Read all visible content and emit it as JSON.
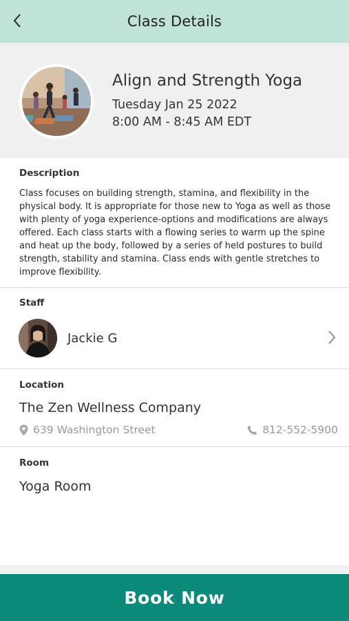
{
  "header": {
    "title": "Class Details"
  },
  "class_info": {
    "name": "Align and Strength Yoga",
    "date": "Tuesday Jan 25 2022",
    "time": "8:00 AM - 8:45 AM EDT"
  },
  "description": {
    "label": "Description",
    "text": "Class focuses on building strength, stamina, and flexibility in the physical body. It is appropriate for those new to Yoga as well as those with plenty of yoga experience-options and modifications are always offered. Each class starts with a flowing series to warm up the spine and heat up the body, followed by a series of held postures to build strength, stability and stamina. Class ends with gentle stretches to improve flexibility."
  },
  "staff": {
    "label": "Staff",
    "name": "Jackie G"
  },
  "location": {
    "label": "Location",
    "name": "The Zen Wellness Company",
    "address": "639 Washington Street",
    "phone": "812-552-5900"
  },
  "room": {
    "label": "Room",
    "name": "Yoga Room"
  },
  "actions": {
    "book_label": "Book Now"
  },
  "colors": {
    "header_bg": "#bfe3d6",
    "hero_bg": "#f0f0f0",
    "accent": "#0b8a7c",
    "muted_text": "#9a9a9a"
  },
  "icons": [
    "chevron-left-icon",
    "chevron-right-icon",
    "map-pin-icon",
    "phone-icon"
  ]
}
